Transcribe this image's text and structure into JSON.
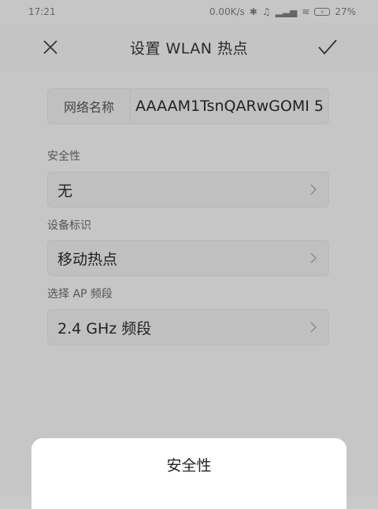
{
  "status_bar": {
    "time": "17:21",
    "net_speed": "0.00K/s",
    "battery": "27%"
  },
  "header": {
    "title": "设置 WLAN 热点"
  },
  "form": {
    "network_name_label": "网络名称",
    "network_name_value": "AAAAM1TsnQARwGOMI 5",
    "security_label": "安全性",
    "security_value": "无",
    "device_id_label": "设备标识",
    "device_id_value": "移动热点",
    "ap_band_label": "选择 AP 频段",
    "ap_band_value": "2.4 GHz 频段"
  },
  "sheet": {
    "title": "安全性"
  }
}
